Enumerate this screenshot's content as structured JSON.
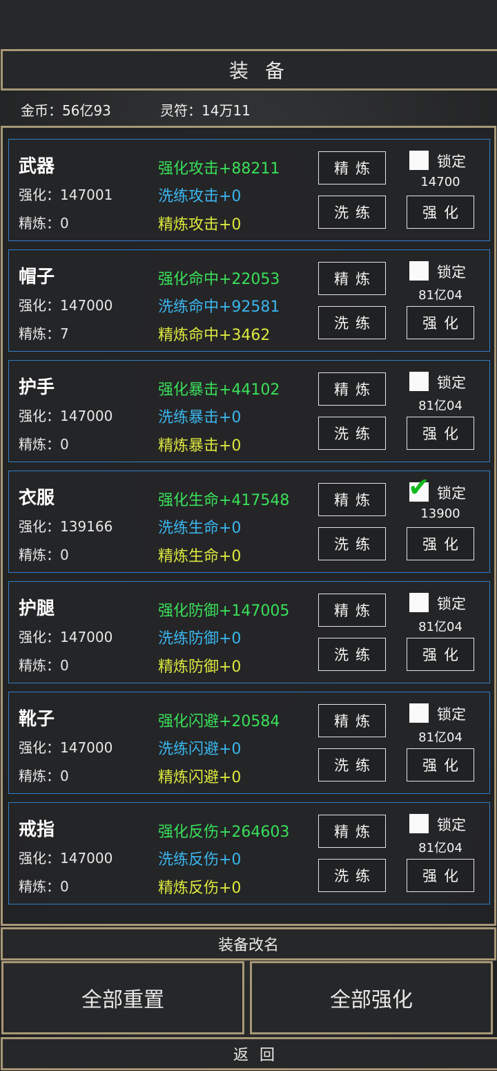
{
  "title": "装备",
  "currency": {
    "gold": "金币：56亿93",
    "talisman": "灵符：14万11"
  },
  "buttons": {
    "refine": "精炼",
    "wash": "洗练",
    "strengthen": "强化",
    "lock": "锁定"
  },
  "items": [
    {
      "name": "武器",
      "enh": "强化：147001",
      "ref": "精炼：0",
      "s1": "强化攻击+88211",
      "s2": "洗练攻击+0",
      "s3": "精炼攻击+0",
      "locked": false,
      "cost": "14700"
    },
    {
      "name": "帽子",
      "enh": "强化：147000",
      "ref": "精炼：7",
      "s1": "强化命中+22053",
      "s2": "洗练命中+92581",
      "s3": "精炼命中+3462",
      "locked": false,
      "cost": "81亿04"
    },
    {
      "name": "护手",
      "enh": "强化：147000",
      "ref": "精炼：0",
      "s1": "强化暴击+44102",
      "s2": "洗练暴击+0",
      "s3": "精炼暴击+0",
      "locked": false,
      "cost": "81亿04"
    },
    {
      "name": "衣服",
      "enh": "强化：139166",
      "ref": "精炼：0",
      "s1": "强化生命+417548",
      "s2": "洗练生命+0",
      "s3": "精炼生命+0",
      "locked": true,
      "cost": "13900"
    },
    {
      "name": "护腿",
      "enh": "强化：147000",
      "ref": "精炼：0",
      "s1": "强化防御+147005",
      "s2": "洗练防御+0",
      "s3": "精炼防御+0",
      "locked": false,
      "cost": "81亿04"
    },
    {
      "name": "靴子",
      "enh": "强化：147000",
      "ref": "精炼：0",
      "s1": "强化闪避+20584",
      "s2": "洗练闪避+0",
      "s3": "精炼闪避+0",
      "locked": false,
      "cost": "81亿04"
    },
    {
      "name": "戒指",
      "enh": "强化：147000",
      "ref": "精炼：0",
      "s1": "强化反伤+264603",
      "s2": "洗练反伤+0",
      "s3": "精炼反伤+0",
      "locked": false,
      "cost": "81亿04"
    }
  ],
  "footer": {
    "rename": "装备改名",
    "reset_all": "全部重置",
    "strengthen_all": "全部强化",
    "back": "返回"
  }
}
